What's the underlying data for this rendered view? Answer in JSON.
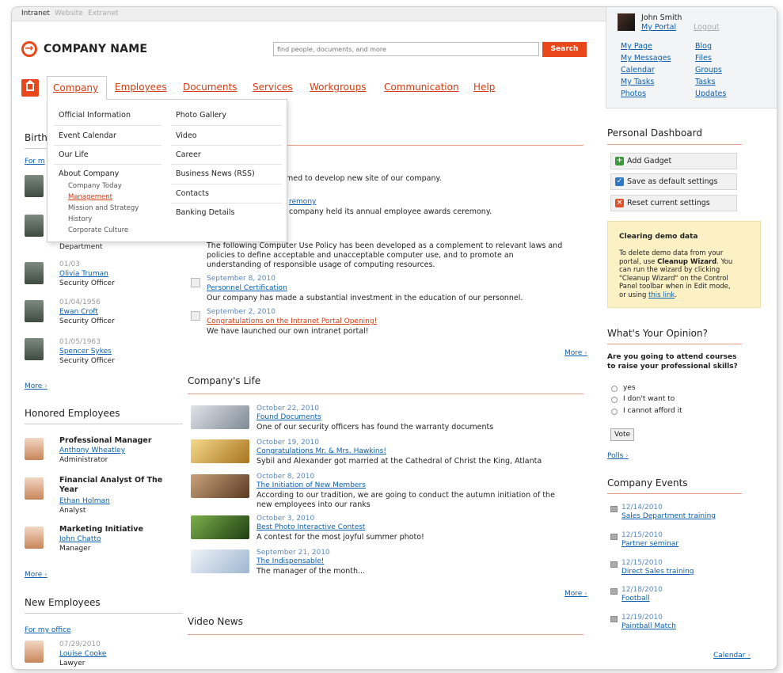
{
  "topbar": {
    "tabs": [
      "Intranet",
      "Website",
      "Extranet"
    ]
  },
  "header": {
    "company_name": "COMPANY NAME",
    "search_placeholder": "find people, documents, and more",
    "search_button": "Search"
  },
  "nav": {
    "items": [
      "Company",
      "Employees",
      "Documents",
      "Services",
      "Workgroups",
      "Communication",
      "Help"
    ]
  },
  "dropdown": {
    "left": [
      "Official Information",
      "Event Calendar",
      "Our Life",
      "About Company"
    ],
    "sub": [
      "Company Today",
      "Management",
      "Mission and Strategy",
      "History",
      "Corporate Culture"
    ],
    "right": [
      "Photo Gallery",
      "Video",
      "Career",
      "Business News (RSS)",
      "Contacts",
      "Banking Details"
    ]
  },
  "left": {
    "birthdays_title": "Birth",
    "for_my_office": "For m",
    "people": [
      {
        "date": "",
        "name": "",
        "role": "Department"
      },
      {
        "date": "01/03",
        "name": "Olivia Truman",
        "role": "Security Officer"
      },
      {
        "date": "01/04/1956",
        "name": "Ewan Croft",
        "role": "Security Officer"
      },
      {
        "date": "01/05/1963",
        "name": "Spencer Sykes",
        "role": "Security Officer"
      }
    ],
    "more": "More",
    "honored_title": "Honored Employees",
    "honored": [
      {
        "title": "Professional Manager",
        "name": "Anthony Wheatley",
        "role": "Administrator"
      },
      {
        "title": "Financial Analyst Of The Year",
        "name": "Ethan Holman",
        "role": "Analyst"
      },
      {
        "title": "Marketing Initiative",
        "name": "John Chatto",
        "role": "Manager"
      }
    ],
    "more2": "More",
    "new_title": "New Employees",
    "new_for_office": "For my office",
    "new": {
      "date": "07/29/2010",
      "name": "Louise Cooke",
      "role": "Lawyer"
    }
  },
  "news": {
    "partial1": "med to develop new site of our company.",
    "partial2_link": "remony",
    "partial2_text": "company held its annual employee awards ceremony.",
    "policy_text1": "The following Computer Use Policy has been developed as a complement to relevant laws and",
    "policy_text2": "policies to define acceptable and unacceptable computer use, and to promote an",
    "policy_text3": "understanding of responsible usage of computing resources.",
    "items": [
      {
        "date": "September 8, 2010",
        "title": "Personnel Certification",
        "text": "Our company has made a substantial investment in the education of our personnel."
      },
      {
        "date": "September 2, 2010",
        "title": "Congratulations on the Intranet Portal Opening!",
        "text": "We have launched our own intranet portal!"
      }
    ],
    "more": "More"
  },
  "life": {
    "title": "Company's Life",
    "items": [
      {
        "date": "October 22, 2010",
        "title": "Found Documents",
        "text": "One of our security officers has found the warranty documents",
        "text2": ""
      },
      {
        "date": "October 19, 2010",
        "title": "Congratulations Mr. & Mrs. Hawkins!",
        "text": "Sybil and Alexander got married at the Cathedral of Christ the King, Atlanta",
        "text2": ""
      },
      {
        "date": "October 8, 2010",
        "title": "The Initiation of New Members",
        "text": "According to our tradition, we are going to conduct the autumn initiation of the",
        "text2": "new employees into our ranks"
      },
      {
        "date": "October 3, 2010",
        "title": "Best Photo Interactive Contest",
        "text": "A contest for the most joyful summer photo!",
        "text2": ""
      },
      {
        "date": "September 21, 2010",
        "title": "The Indispensable!",
        "text": "The manager of the month...",
        "text2": ""
      }
    ],
    "more": "More"
  },
  "video": {
    "title": "Video News"
  },
  "user": {
    "name": "John Smith",
    "my_portal": "My Portal",
    "logout": "Logout",
    "links_left": [
      "My Page",
      "My Messages",
      "Calendar",
      "My Tasks",
      "Photos"
    ],
    "links_right": [
      "Blog",
      "Files",
      "Groups",
      "Tasks",
      "Updates"
    ]
  },
  "dashboard": {
    "title": "Personal Dashboard",
    "add_gadget": "Add Gadget",
    "save_default": "Save as default settings",
    "reset": "Reset current settings"
  },
  "demo": {
    "title": "Clearing demo data",
    "text1": "To delete demo data from your",
    "text2a": "portal, use ",
    "text2b": "Cleanup Wizard",
    "text2c": ". You",
    "text3": "can run the wizard by clicking",
    "text4": "\"Cleanup Wizard\" on the Control",
    "text5": "Panel toolbar when in Edit mode,",
    "text6a": "or using ",
    "text6b": "this link",
    "text6c": "."
  },
  "poll": {
    "title": "What's Your Opinion?",
    "question1": "Are you going to attend courses",
    "question2": "to raise your professional skills?",
    "options": [
      "yes",
      "I don't want to",
      "I cannot afford it"
    ],
    "vote": "Vote",
    "polls_link": "Polls"
  },
  "events": {
    "title": "Company Events",
    "items": [
      {
        "date": "12/14/2010",
        "name": "Sales Department training"
      },
      {
        "date": "12/15/2010",
        "name": "Partner seminar"
      },
      {
        "date": "12/15/2010",
        "name": "Direct Sales training"
      },
      {
        "date": "12/18/2010",
        "name": "Football"
      },
      {
        "date": "12/19/2010",
        "name": "Paintball Match"
      }
    ],
    "calendar": "Calendar"
  },
  "colors": {
    "accent": "#e8471c",
    "link": "#0b5fb0"
  }
}
